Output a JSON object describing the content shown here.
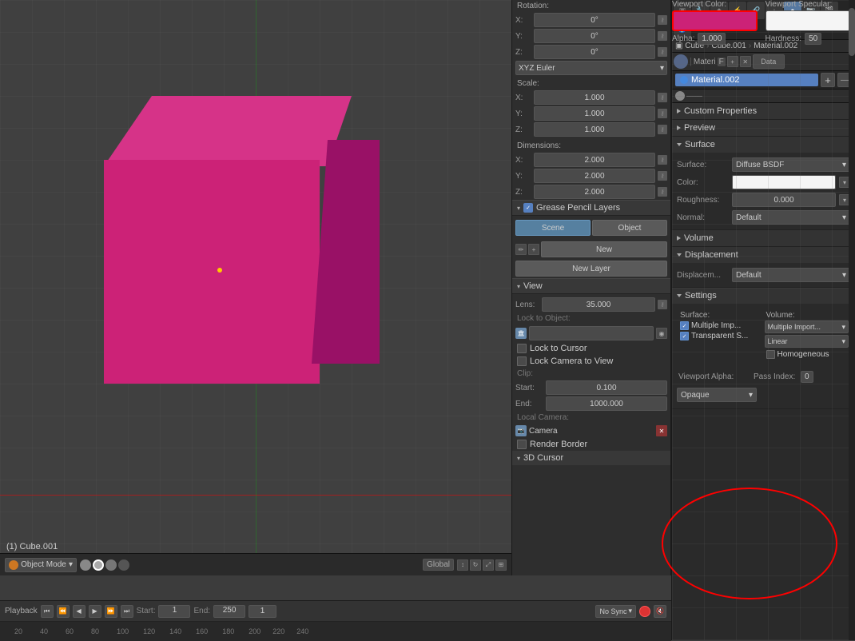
{
  "viewport": {
    "object_label": "(1) Cube.001"
  },
  "side_panel": {
    "rotation_label": "Rotation:",
    "rotation": {
      "x_label": "X:",
      "x_value": "0°",
      "y_label": "Y:",
      "y_value": "0°",
      "z_label": "Z:",
      "z_value": "0°"
    },
    "euler_dropdown": "XYZ Euler",
    "scale_label": "Scale:",
    "scale": {
      "x_label": "X:",
      "x_value": "1.000",
      "y_label": "Y:",
      "y_value": "1.000",
      "z_label": "Z:",
      "z_value": "1.000"
    },
    "dimensions_label": "Dimensions:",
    "dimensions": {
      "x_label": "X:",
      "x_value": "2.000",
      "y_label": "Y:",
      "y_value": "2.000",
      "z_label": "Z:",
      "z_value": "2.000"
    },
    "grease_pencil_layers": "Grease Pencil Layers",
    "scene_btn": "Scene",
    "object_btn": "Object",
    "new_btn": "New",
    "new_layer_btn": "New Layer",
    "view_label": "View",
    "lens_label": "Lens:",
    "lens_value": "35.000",
    "lock_object_label": "Lock to Object:",
    "lock_to_cursor": "Lock to Cursor",
    "lock_camera_to_view": "Lock Camera to View",
    "clip_label": "Clip:",
    "clip_start_label": "Start:",
    "clip_start_value": "0.100",
    "clip_end_label": "End:",
    "clip_end_value": "1000.000",
    "local_camera_label": "Local Camera:",
    "camera_name": "Camera",
    "render_border": "Render Border",
    "cursor_3d": "3D Cursor"
  },
  "properties": {
    "title": "Custom Properties",
    "material_name": "Material.002",
    "preview_label": "Preview",
    "surface_label": "Surface",
    "surface_type_label": "Surface:",
    "surface_type_value": "Diffuse BSDF",
    "color_label": "Color:",
    "roughness_label": "Roughness:",
    "roughness_value": "0.000",
    "normal_label": "Normal:",
    "normal_value": "Default",
    "volume_label": "Volume",
    "displacement_label": "Displacement",
    "displacement_value": "Default",
    "settings_label": "Settings",
    "surface_sub": "Surface:",
    "volume_sub": "Volume:",
    "multiple_imp_left": "Multiple Imp...",
    "multiple_imp_right": "Multiple Import...",
    "transparent_s": "Transparent S...",
    "linear": "Linear",
    "homogeneous": "Homogeneous",
    "viewport_color_label": "Viewport Color:",
    "viewport_specular_label": "Viewport Specular:",
    "alpha_label": "Alpha:",
    "alpha_value": "1.000",
    "hardness_label": "Hardness:",
    "hardness_value": "50",
    "viewport_alpha_label": "Viewport Alpha:",
    "pass_index_label": "Pass Index:",
    "pass_index_value": "0",
    "opaque_label": "Opaque",
    "tabs": {
      "object": "●",
      "modifier": "🔧",
      "particle": "◆",
      "physics": "☷",
      "constraint": "🔗",
      "data": "Data",
      "material": "M",
      "render": "R",
      "scene": "S",
      "world": "W"
    },
    "breadcrumb": {
      "cube": "Cube",
      "cube_001": "Cube.001",
      "material_002": "Material.002"
    }
  },
  "timeline": {
    "playback_label": "Playback",
    "start_label": "Start:",
    "start_value": "1",
    "end_label": "End:",
    "end_value": "250",
    "current_frame": "1",
    "sync_label": "No Sync",
    "frame_numbers": [
      "20",
      "40",
      "60",
      "80",
      "100",
      "120",
      "140",
      "160",
      "180",
      "200",
      "220",
      "240"
    ]
  }
}
